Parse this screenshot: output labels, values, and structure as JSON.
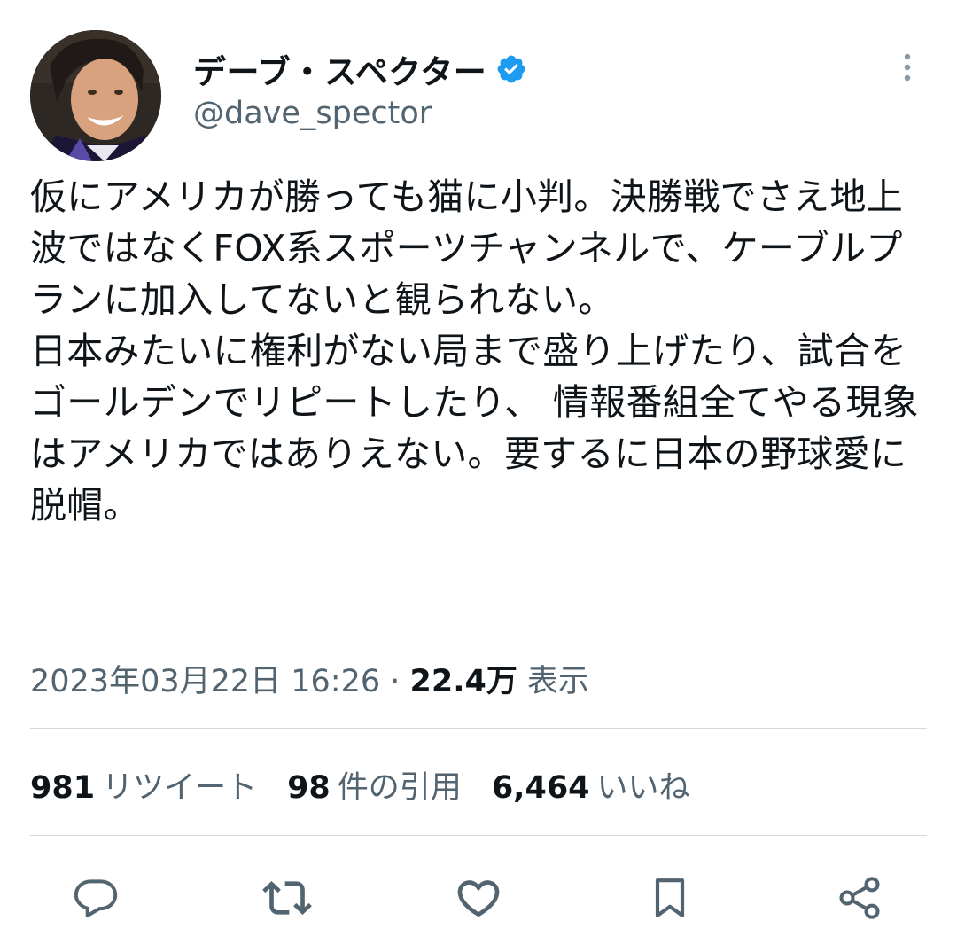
{
  "author": {
    "display_name": "デーブ・スペクター",
    "handle": "@dave_spector",
    "verified": true
  },
  "tweet": {
    "text": "仮にアメリカが勝っても猫に小判。決勝戦でさえ地上波ではなくFOX系スポーツチャンネルで、ケーブルプランに加入してないと観られない。\n日本みたいに権利がない局まで盛り上げたり、試合をゴールデンでリピートしたり、 情報番組全てやる現象はアメリカではありえない。要するに日本の野球愛に脱帽。"
  },
  "meta": {
    "timestamp": "2023年03月22日 16:26",
    "separator": " · ",
    "views_count": "22.4万",
    "views_label": "表示"
  },
  "stats": {
    "retweets": {
      "count": "981",
      "label": "リツイート"
    },
    "quotes": {
      "count": "98",
      "label": "件の引用"
    },
    "likes": {
      "count": "6,464",
      "label": "いいね"
    }
  },
  "colors": {
    "text_primary": "#0f1419",
    "text_secondary": "#536471",
    "divider": "#cfd9de",
    "verified_blue": "#1d9bf0"
  },
  "icons": {
    "more": "more-vertical-icon",
    "reply": "reply-icon",
    "retweet": "retweet-icon",
    "like": "heart-icon",
    "bookmark": "bookmark-icon",
    "share": "share-icon",
    "verified": "verified-badge-icon"
  }
}
